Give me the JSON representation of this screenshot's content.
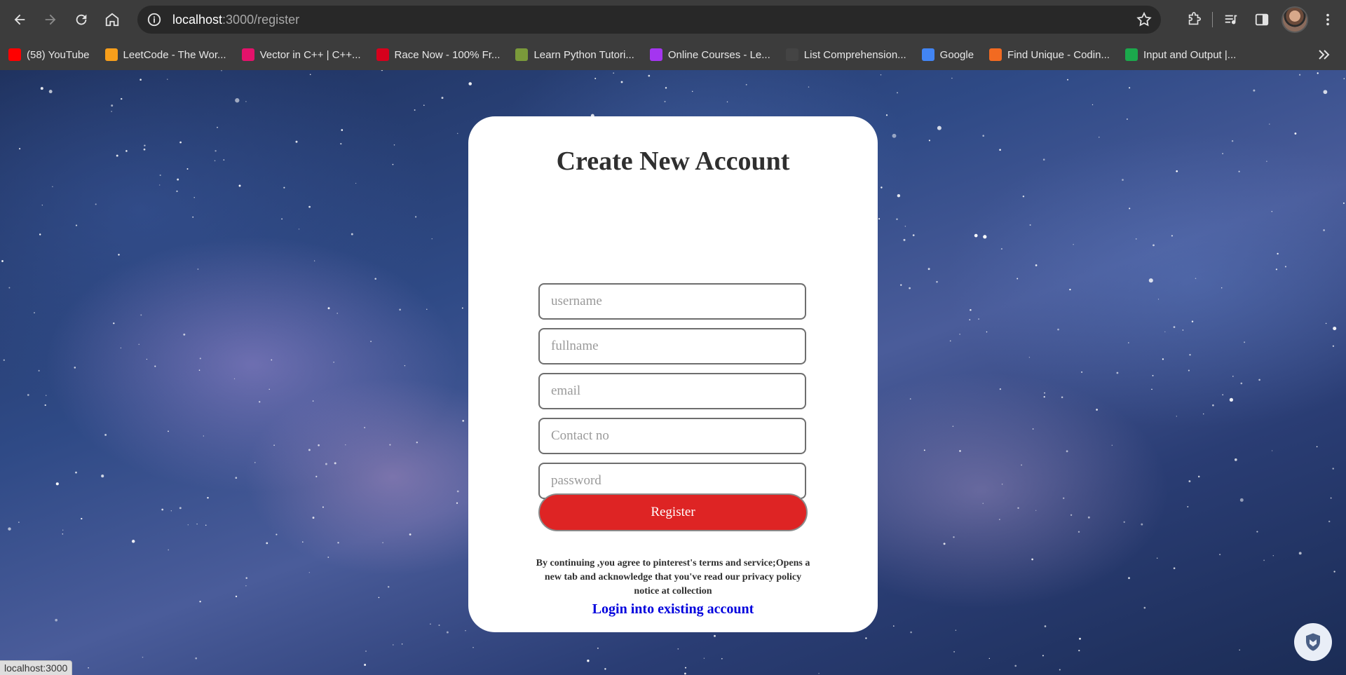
{
  "browser": {
    "url_host": "localhost",
    "url_path": ":3000/register",
    "bookmarks": [
      {
        "label": "(58) YouTube",
        "icon": "youtube-icon",
        "color": "#ff0000"
      },
      {
        "label": "LeetCode - The Wor...",
        "icon": "leetcode-icon",
        "color": "#f89f1b"
      },
      {
        "label": "Vector in C++ | C++...",
        "icon": "tutorial-icon",
        "color": "#e4126b"
      },
      {
        "label": "Race Now - 100% Fr...",
        "icon": "nitro-icon",
        "color": "#d6001c"
      },
      {
        "label": "Learn Python Tutori...",
        "icon": "python-icon",
        "color": "#7a9a3a"
      },
      {
        "label": "Online Courses - Le...",
        "icon": "udemy-icon",
        "color": "#a435f0"
      },
      {
        "label": "List Comprehension...",
        "icon": "gear-icon",
        "color": "#444444"
      },
      {
        "label": "Google",
        "icon": "google-icon",
        "color": "#4285f4"
      },
      {
        "label": "Find Unique - Codin...",
        "icon": "codingninjas-icon",
        "color": "#f26a21"
      },
      {
        "label": "Input and Output |...",
        "icon": "hackerrank-icon",
        "color": "#1ba94c"
      }
    ],
    "status_text": "localhost:3000"
  },
  "form": {
    "title": "Create New Account",
    "placeholders": {
      "username": "username",
      "fullname": "fullname",
      "email": "email",
      "contact": "Contact no",
      "password": "password"
    },
    "register_label": "Register",
    "terms_text": "By continuing ,you agree to pinterest's terms and service;Opens a new tab and acknowledge that you've read our privacy policy notice at collection",
    "login_link": "Login into existing account"
  },
  "colors": {
    "accent_button": "#de2424",
    "link": "#0000dd"
  }
}
